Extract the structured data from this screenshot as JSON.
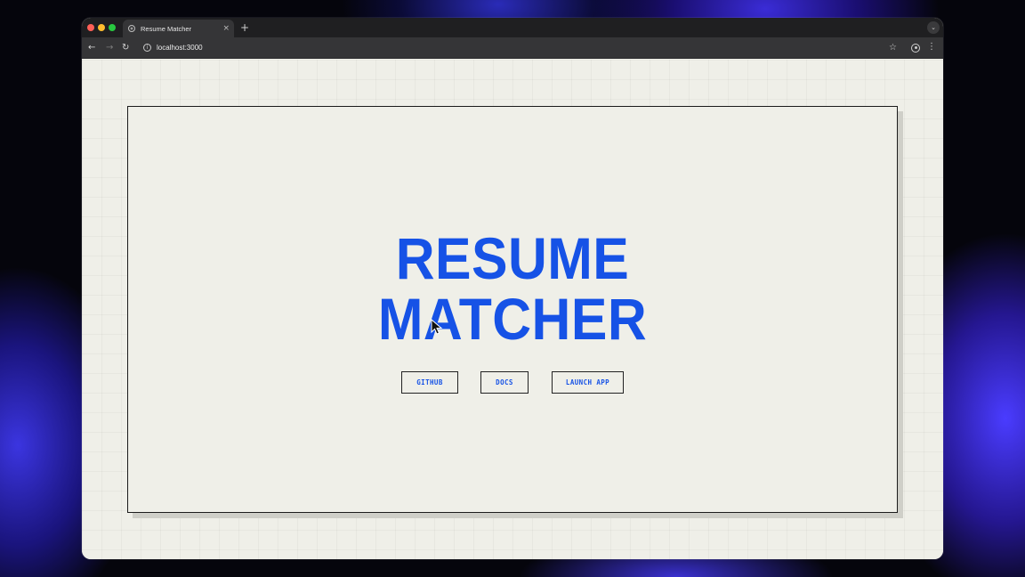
{
  "browser": {
    "tab_title": "Resume Matcher",
    "tab_close": "×",
    "new_tab": "+",
    "url": "localhost:3000",
    "nav_back": "←",
    "nav_forward": "→",
    "nav_reload": "↻",
    "star": "☆",
    "menu": "⋮",
    "tab_menu": "⌄"
  },
  "page": {
    "hero_line1": "RESUME",
    "hero_line2": "MATCHER",
    "buttons": {
      "github": "GITHUB",
      "docs": "DOCS",
      "launch": "LAUNCH APP"
    }
  },
  "colors": {
    "accent": "#1652e6",
    "background": "#efefe8",
    "border": "#1c1c1c"
  }
}
